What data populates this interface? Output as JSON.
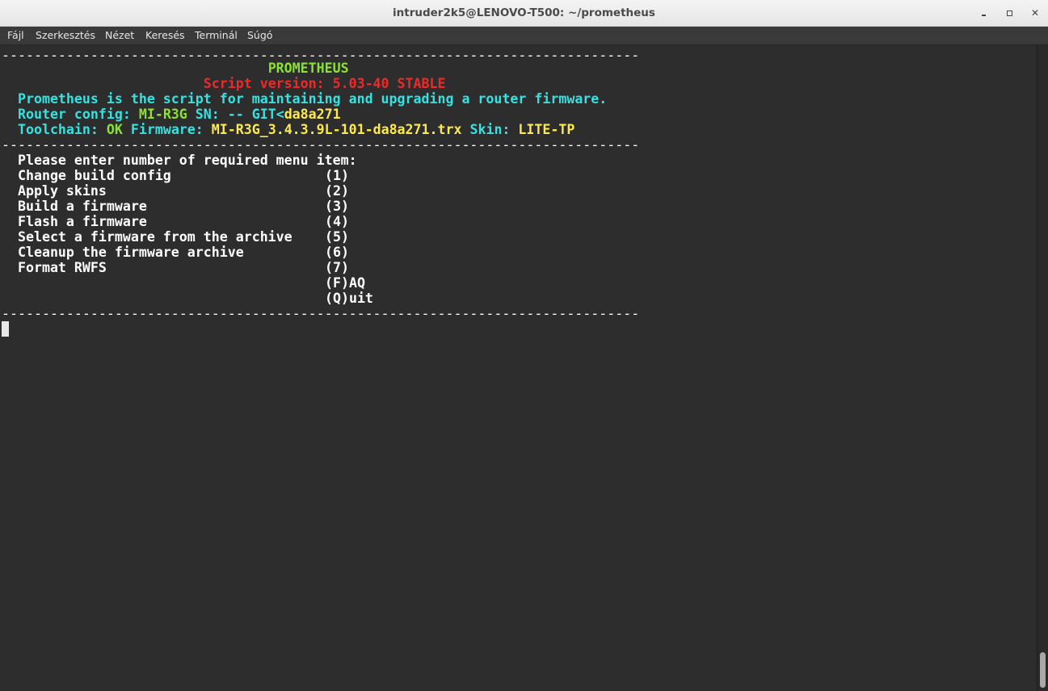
{
  "window": {
    "title": "intruder2k5@LENOVO-T500: ~/prometheus"
  },
  "menubar": {
    "items": [
      "Fájl",
      "Szerkesztés",
      "Nézet",
      "Keresés",
      "Terminál",
      "Súgó"
    ]
  },
  "terminal": {
    "separator": "-------------------------------------------------------------------------------",
    "header": {
      "name": "PROMETHEUS",
      "version_label": "Script version: 5.03-40 STABLE",
      "description": "Prometheus is the script for maintaining and upgrading a router firmware.",
      "router_label": "Router config: ",
      "router_value": "MI-R3G",
      "sn_label": " SN: -- GIT<",
      "sn_value": "da8a271",
      "toolchain_label": "Toolchain: ",
      "toolchain_value": "OK",
      "firmware_label": " Firmware: ",
      "firmware_value": "MI-R3G_3.4.3.9L-101-da8a271.trx",
      "skin_label": " Skin: ",
      "skin_value": "LITE-TP"
    },
    "prompt": "Please enter number of required menu item:",
    "menu": [
      {
        "label": "Change build config",
        "key": "(1)"
      },
      {
        "label": "Apply skins",
        "key": "(2)"
      },
      {
        "label": "Build a firmware",
        "key": "(3)"
      },
      {
        "label": "Flash a firmware",
        "key": "(4)"
      },
      {
        "label": "Select a firmware from the archive",
        "key": "(5)"
      },
      {
        "label": "Cleanup the firmware archive",
        "key": "(6)"
      },
      {
        "label": "Format RWFS",
        "key": "(7)"
      },
      {
        "label": "",
        "key": "(F)AQ"
      },
      {
        "label": "",
        "key": "(Q)uit"
      }
    ]
  },
  "colors": {
    "background": "#2d2d2d",
    "green": "#8ae234",
    "red": "#ef2929",
    "cyan": "#34e2e2",
    "yellow": "#fce94f"
  }
}
